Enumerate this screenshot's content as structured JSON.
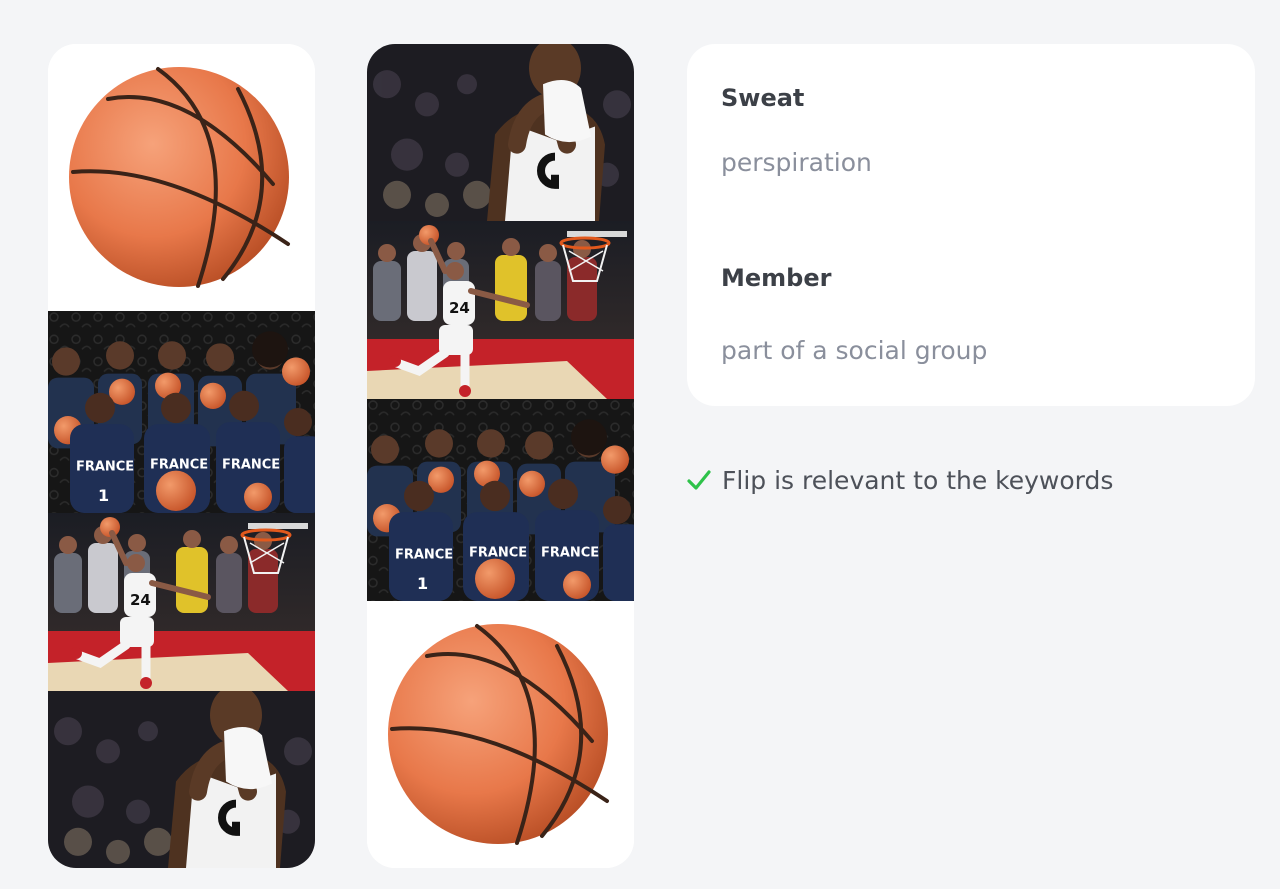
{
  "columns": {
    "left": {
      "tiles": [
        {
          "icon": "basketball-image"
        },
        {
          "icon": "team-france-photo"
        },
        {
          "icon": "player-dunk-photo"
        },
        {
          "icon": "player-sweat-photo"
        }
      ]
    },
    "right": {
      "tiles": [
        {
          "icon": "player-sweat-photo"
        },
        {
          "icon": "player-dunk-photo"
        },
        {
          "icon": "team-france-photo"
        },
        {
          "icon": "basketball-image"
        }
      ]
    }
  },
  "definitions": [
    {
      "term": "Sweat",
      "definition": "perspiration"
    },
    {
      "term": "Member",
      "definition": "part of a social group"
    }
  ],
  "status": {
    "icon": "checkmark-icon",
    "text": "Flip is relevant to the keywords",
    "color": "#2ec24a"
  },
  "colors": {
    "background": "#f4f5f7",
    "card": "#ffffff",
    "ball": "#e8784a",
    "jersey_france": "#1f2f55",
    "court_red": "#c9202a"
  }
}
